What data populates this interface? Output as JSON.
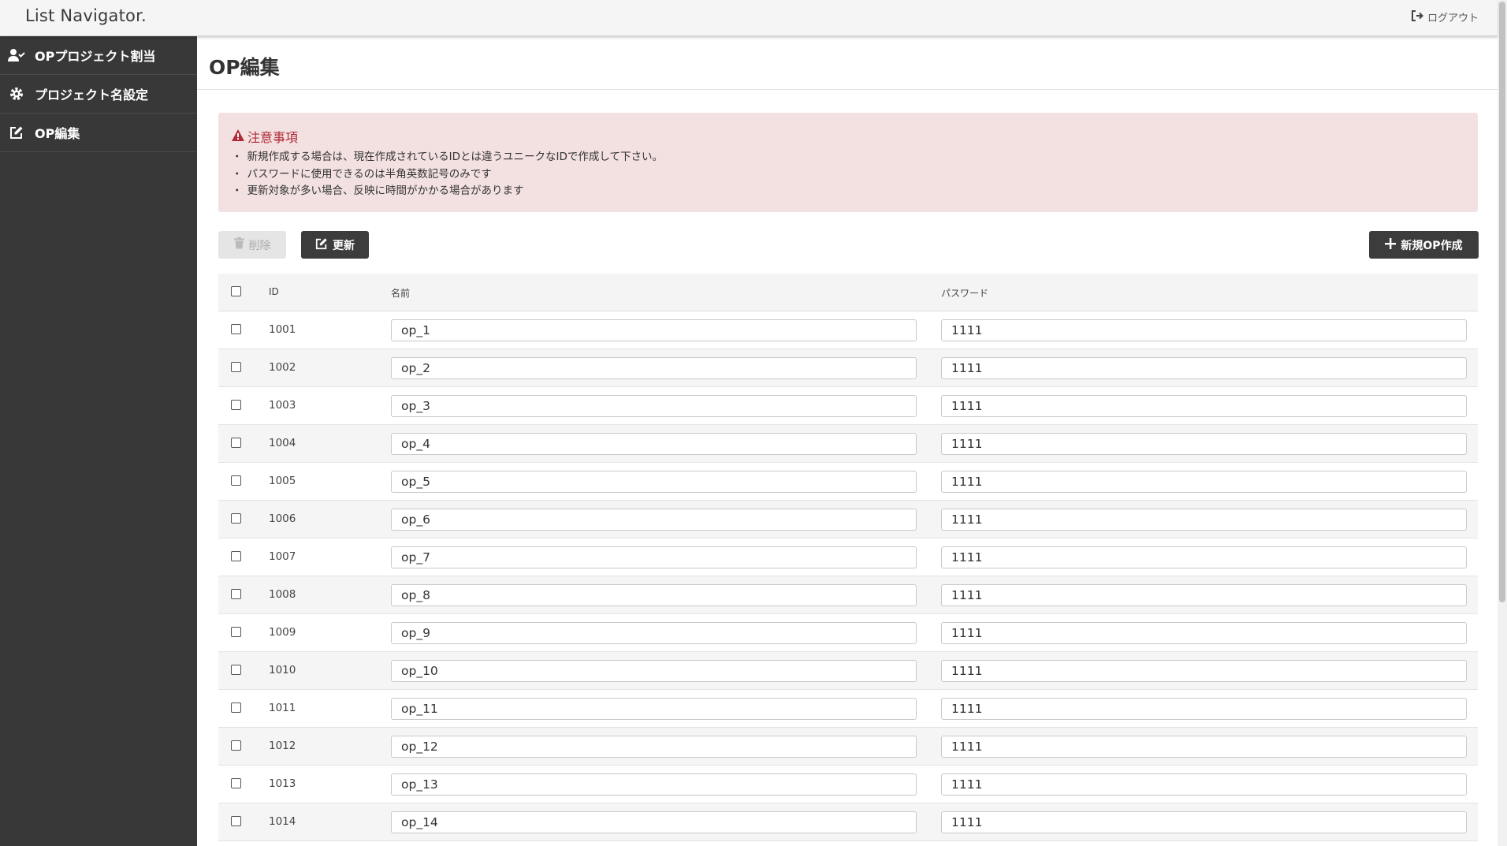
{
  "header": {
    "brand": "List Navigator.",
    "logout_label": "ログアウト"
  },
  "sidebar": {
    "items": [
      {
        "label": "OPプロジェクト割当",
        "icon": "user-check-icon"
      },
      {
        "label": "プロジェクト名設定",
        "icon": "gear-icon"
      },
      {
        "label": "OP編集",
        "icon": "edit-icon"
      }
    ]
  },
  "main": {
    "title": "OP編集",
    "notice": {
      "title": "注意事項",
      "items": [
        "新規作成する場合は、現在作成されているIDとは違うユニークなIDで作成して下さい。",
        "パスワードに使用できるのは半角英数記号のみです",
        "更新対象が多い場合、反映に時間がかかる場合があります"
      ]
    },
    "toolbar": {
      "delete_label": "削除",
      "update_label": "更新",
      "new_label": "新規OP作成"
    },
    "table": {
      "headers": {
        "id": "ID",
        "name": "名前",
        "password": "パスワード"
      },
      "rows": [
        {
          "id": "1001",
          "name": "op_1",
          "password": "1111"
        },
        {
          "id": "1002",
          "name": "op_2",
          "password": "1111"
        },
        {
          "id": "1003",
          "name": "op_3",
          "password": "1111"
        },
        {
          "id": "1004",
          "name": "op_4",
          "password": "1111"
        },
        {
          "id": "1005",
          "name": "op_5",
          "password": "1111"
        },
        {
          "id": "1006",
          "name": "op_6",
          "password": "1111"
        },
        {
          "id": "1007",
          "name": "op_7",
          "password": "1111"
        },
        {
          "id": "1008",
          "name": "op_8",
          "password": "1111"
        },
        {
          "id": "1009",
          "name": "op_9",
          "password": "1111"
        },
        {
          "id": "1010",
          "name": "op_10",
          "password": "1111"
        },
        {
          "id": "1011",
          "name": "op_11",
          "password": "1111"
        },
        {
          "id": "1012",
          "name": "op_12",
          "password": "1111"
        },
        {
          "id": "1013",
          "name": "op_13",
          "password": "1111"
        },
        {
          "id": "1014",
          "name": "op_14",
          "password": "1111"
        }
      ]
    }
  },
  "colors": {
    "sidebar_bg": "#383838",
    "notice_bg": "#f3e1e2",
    "notice_title": "#b02a37",
    "button_dark": "#3c3c3c"
  }
}
